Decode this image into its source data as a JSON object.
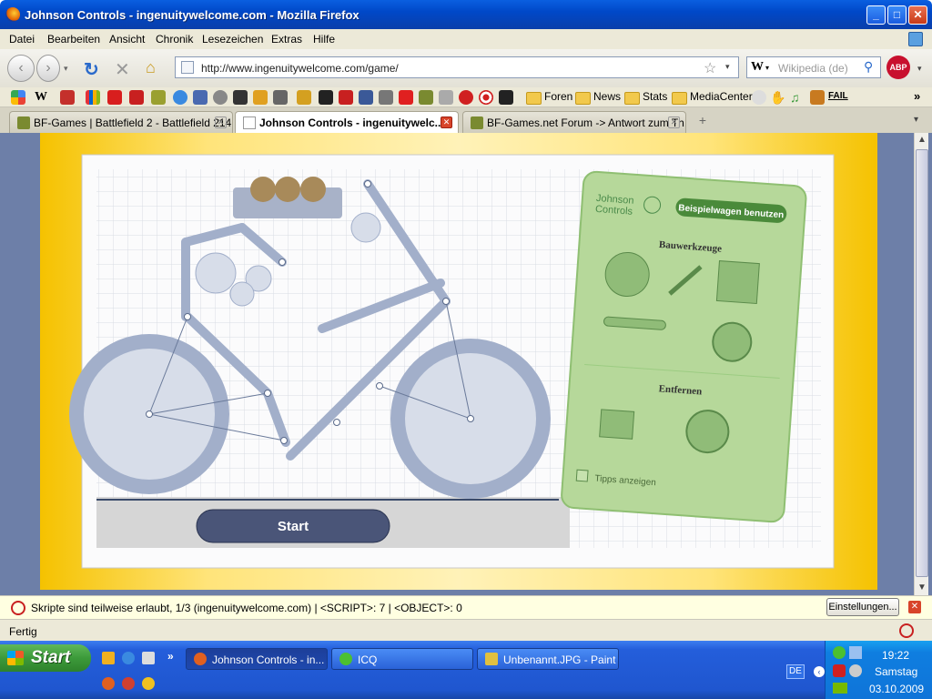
{
  "window": {
    "title": "Johnson Controls - ingenuitywelcome.com - Mozilla Firefox"
  },
  "menu": [
    "Datei",
    "Bearbeiten",
    "Ansicht",
    "Chronik",
    "Lesezeichen",
    "Extras",
    "Hilfe"
  ],
  "nav": {
    "url": "http://www.ingenuitywelcome.com/game/",
    "search_placeholder": "Wikipedia (de)",
    "abp_label": "ABP"
  },
  "bookmarks": {
    "folders": [
      "Foren",
      "News",
      "Stats",
      "MediaCenter"
    ],
    "fail_label": "FAIL"
  },
  "tabs": [
    {
      "label": "BF-Games | Battlefield 2 - Battlefield 214..."
    },
    {
      "label": "Johnson Controls - ingenuitywelc..."
    },
    {
      "label": "BF-Games.net Forum -> Antwort zum Th..."
    }
  ],
  "game": {
    "logo_line1": "Johnson",
    "logo_line2": "Controls",
    "example_button": "Beispielwagen benutzen",
    "tools_heading": "Bauwerkzeuge",
    "remove_heading": "Entfernen",
    "tips_label": "Tipps anzeigen",
    "start_button": "Start"
  },
  "scriptbar": {
    "text": "Skripte sind teilweise erlaubt, 1/3 (ingenuitywelcome.com) | <SCRIPT>: 7 | <OBJECT>: 0",
    "settings_button": "Einstellungen..."
  },
  "status": {
    "text": "Fertig"
  },
  "taskbar": {
    "start_label": "Start",
    "tasks": [
      "Johnson Controls - in...",
      "ICQ",
      "Unbenannt.JPG - Paint"
    ],
    "lang": "DE",
    "time": "19:22",
    "day": "Samstag",
    "date": "03.10.2009"
  }
}
